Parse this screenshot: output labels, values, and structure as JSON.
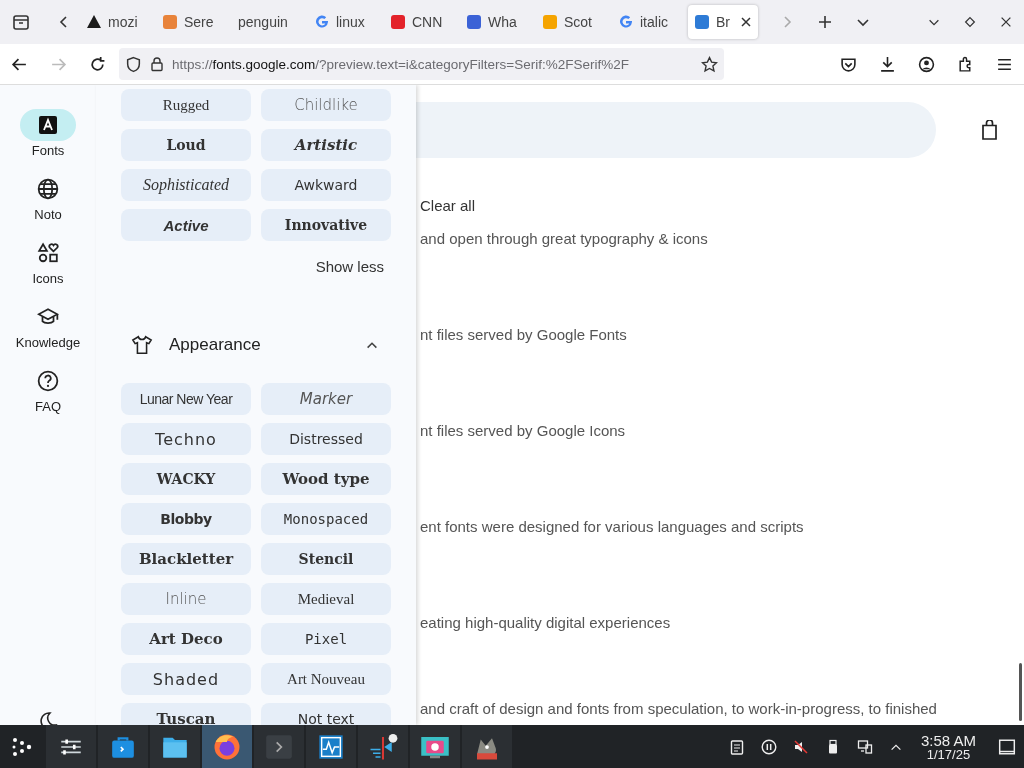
{
  "browser": {
    "tabs": [
      {
        "title": "mozi",
        "selected": false
      },
      {
        "title": "Sere",
        "selected": false
      },
      {
        "title": "penguin",
        "selected": false
      },
      {
        "title": "linux",
        "selected": false
      },
      {
        "title": "CNN",
        "selected": false
      },
      {
        "title": "Wha",
        "selected": false
      },
      {
        "title": "Scot",
        "selected": false
      },
      {
        "title": "italic",
        "selected": false
      },
      {
        "title": "Br",
        "selected": true
      }
    ],
    "url": {
      "scheme": "https://",
      "host": "fonts.google.com",
      "path": "/?preview.text=i&categoryFilters=Serif:%2FSerif%2F"
    }
  },
  "rail": [
    {
      "label": "Fonts",
      "selected": true
    },
    {
      "label": "Noto",
      "selected": false
    },
    {
      "label": "Icons",
      "selected": false
    },
    {
      "label": "Knowledge",
      "selected": false
    },
    {
      "label": "FAQ",
      "selected": false
    }
  ],
  "feeling_chips": [
    "Rugged",
    "Childlike",
    "Loud",
    "Artistic",
    "Sophisticated",
    "Awkward",
    "Active",
    "Innovative"
  ],
  "show_less": "Show less",
  "appearance": {
    "title": "Appearance",
    "expanded": true,
    "chips": [
      "Lunar New Year",
      "Marker",
      "Techno",
      "Distressed",
      "WACKY",
      "Wood type",
      "Blobby",
      "Monospaced",
      "Blackletter",
      "Stencil",
      "Inline",
      "Medieval",
      "Art Deco",
      "Pixel",
      "Shaded",
      "Art Nouveau",
      "Tuscan",
      "Not text"
    ]
  },
  "content": {
    "clear_all": "Clear all",
    "lines": [
      "and open through great typography & icons",
      "nt files served by Google Fonts",
      "nt files served by Google Icons",
      "ent fonts were designed for various languages and scripts",
      "eating high-quality digital experiences",
      "and craft of design and fonts from speculation, to work-in-progress, to finished"
    ]
  },
  "taskbar": {
    "apps": [
      {
        "selected": false
      },
      {
        "selected": false
      },
      {
        "selected": false
      },
      {
        "selected": true
      },
      {
        "selected": false
      },
      {
        "selected": false
      },
      {
        "selected": false
      },
      {
        "selected": false
      },
      {
        "selected": false
      }
    ],
    "time": "3:58 AM",
    "date": "1/17/25"
  }
}
